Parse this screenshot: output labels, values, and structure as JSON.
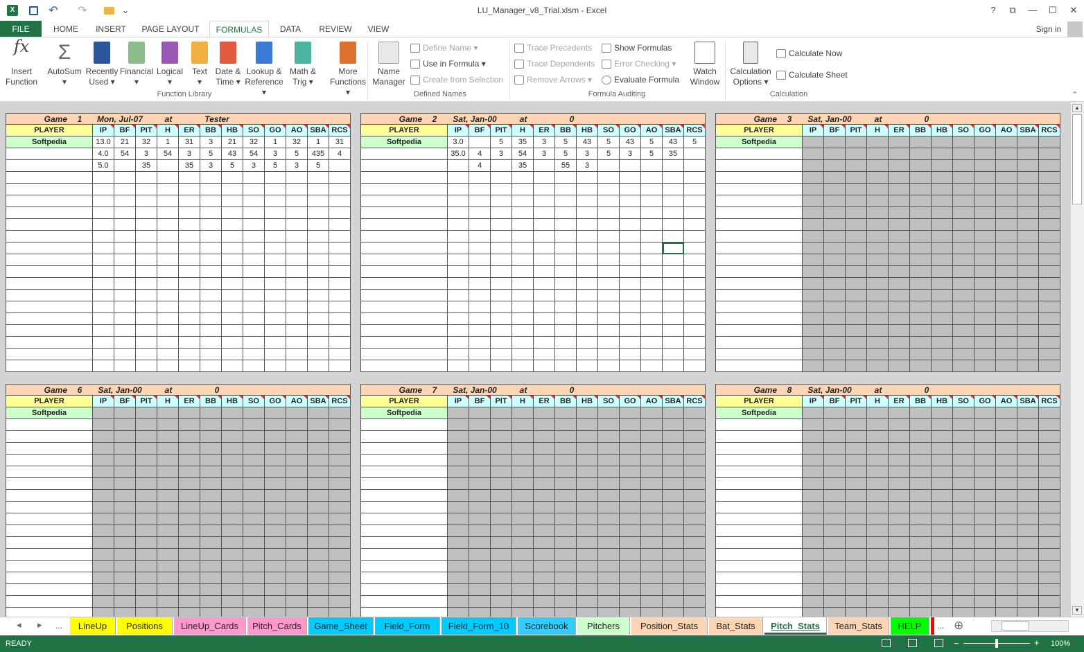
{
  "window": {
    "title": "LU_Manager_v8_Trial.xlsm - Excel",
    "signin": "Sign in",
    "help": "?",
    "restore": "⧉",
    "minimize": "—",
    "maximize": "☐",
    "close": "✕"
  },
  "qat": {
    "undo": "↶",
    "redo": "↷",
    "more": "⌄"
  },
  "ribbon_tabs": [
    "FILE",
    "HOME",
    "INSERT",
    "PAGE LAYOUT",
    "FORMULAS",
    "DATA",
    "REVIEW",
    "VIEW"
  ],
  "function_library": {
    "label": "Function Library",
    "buttons": [
      {
        "l1": "Insert",
        "l2": "Function",
        "icon": "fx-icon"
      },
      {
        "l1": "AutoSum",
        "l2": "▾",
        "icon": "sigma-icon"
      },
      {
        "l1": "Recently",
        "l2": "Used ▾",
        "icon": "star-book-icon"
      },
      {
        "l1": "Financial",
        "l2": "▾",
        "icon": "financial-book-icon"
      },
      {
        "l1": "Logical",
        "l2": "▾",
        "icon": "logical-book-icon"
      },
      {
        "l1": "Text",
        "l2": "▾",
        "icon": "text-book-icon"
      },
      {
        "l1": "Date &",
        "l2": "Time ▾",
        "icon": "calendar-book-icon"
      },
      {
        "l1": "Lookup &",
        "l2": "Reference ▾",
        "icon": "lookup-book-icon"
      },
      {
        "l1": "Math &",
        "l2": "Trig ▾",
        "icon": "math-book-icon"
      },
      {
        "l1": "More",
        "l2": "Functions ▾",
        "icon": "more-book-icon"
      }
    ]
  },
  "defined_names": {
    "label": "Defined Names",
    "name_manager_l1": "Name",
    "name_manager_l2": "Manager",
    "define_name": "Define Name ▾",
    "use_in_formula": "Use in Formula ▾",
    "create_from_selection": "Create from Selection"
  },
  "formula_auditing": {
    "label": "Formula Auditing",
    "trace_precedents": "Trace Precedents",
    "trace_dependents": "Trace Dependents",
    "remove_arrows": "Remove Arrows ▾",
    "show_formulas": "Show Formulas",
    "error_checking": "Error Checking ▾",
    "evaluate_formula": "Evaluate Formula",
    "watch_l1": "Watch",
    "watch_l2": "Window"
  },
  "calculation": {
    "label": "Calculation",
    "options_l1": "Calculation",
    "options_l2": "Options ▾",
    "calc_now": "Calculate Now",
    "calc_sheet": "Calculate Sheet"
  },
  "columns": [
    "PLAYER",
    "IP",
    "BF",
    "PIT",
    "H",
    "ER",
    "BB",
    "HB",
    "SO",
    "GO",
    "AO",
    "SBA",
    "RCS"
  ],
  "games": [
    {
      "game": "Game",
      "num": "1",
      "date": "Mon, Jul-07",
      "at": "at",
      "opp": "Tester",
      "player": "Softpedia",
      "grey": false,
      "rows": [
        [
          "13.0",
          "21",
          "32",
          "1",
          "31",
          "3",
          "21",
          "32",
          "1",
          "32",
          "1",
          "31"
        ],
        [
          "4.0",
          "54",
          "3",
          "54",
          "3",
          "5",
          "43",
          "54",
          "3",
          "5",
          "435",
          "4"
        ],
        [
          "5.0",
          "",
          "35",
          "",
          "35",
          "3",
          "5",
          "3",
          "5",
          "3",
          "5",
          ""
        ]
      ]
    },
    {
      "game": "Game",
      "num": "2",
      "date": "Sat, Jan-00",
      "at": "at",
      "opp": "0",
      "player": "Softpedia",
      "grey": false,
      "rows": [
        [
          "3.0",
          "",
          "5",
          "35",
          "3",
          "5",
          "43",
          "5",
          "43",
          "5",
          "43",
          "5"
        ],
        [
          "35.0",
          "4",
          "3",
          "54",
          "3",
          "5",
          "3",
          "5",
          "3",
          "5",
          "35",
          ""
        ],
        [
          "",
          "4",
          "",
          "35",
          "",
          "55",
          "3",
          "",
          "",
          "",
          "",
          ""
        ]
      ]
    },
    {
      "game": "Game",
      "num": "3",
      "date": "Sat, Jan-00",
      "at": "at",
      "opp": "0",
      "player": "Softpedia",
      "grey": true,
      "rows": []
    },
    {
      "game": "Game",
      "num": "6",
      "date": "Sat, Jan-00",
      "at": "at",
      "opp": "0",
      "player": "Softpedia",
      "grey": true,
      "rows": []
    },
    {
      "game": "Game",
      "num": "7",
      "date": "Sat, Jan-00",
      "at": "at",
      "opp": "0",
      "player": "Softpedia",
      "grey": true,
      "rows": []
    },
    {
      "game": "Game",
      "num": "8",
      "date": "Sat, Jan-00",
      "at": "at",
      "opp": "0",
      "player": "Softpedia",
      "grey": true,
      "rows": []
    }
  ],
  "sheet_tabs": [
    {
      "label": "LineUp",
      "color": "#ffff00"
    },
    {
      "label": "Positions",
      "color": "#ffff00"
    },
    {
      "label": "LineUp_Cards",
      "color": "#ff99cc"
    },
    {
      "label": "Pitch_Cards",
      "color": "#ff99cc"
    },
    {
      "label": "Game_Sheet",
      "color": "#00ccff"
    },
    {
      "label": "Field_Form",
      "color": "#00ccff"
    },
    {
      "label": "Field_Form_10",
      "color": "#00ccff"
    },
    {
      "label": "Scorebook",
      "color": "#33ccff"
    },
    {
      "label": "Pitchers",
      "color": "#ccffcc"
    },
    {
      "label": "Position_Stats",
      "color": "#fcd5b4"
    },
    {
      "label": "Bat_Stats",
      "color": "#fcd5b4"
    },
    {
      "label": "Pitch_Stats",
      "color": "#ffffff"
    },
    {
      "label": "Team_Stats",
      "color": "#fcd5b4"
    },
    {
      "label": "HELP",
      "color": "#00ff00"
    }
  ],
  "tab_nav": {
    "prev": "◂",
    "next": "▸",
    "more": "...",
    "more_right": "...",
    "add": "⊕"
  },
  "status": {
    "ready": "READY",
    "zoom": "100%",
    "minus": "−",
    "plus": "+"
  }
}
